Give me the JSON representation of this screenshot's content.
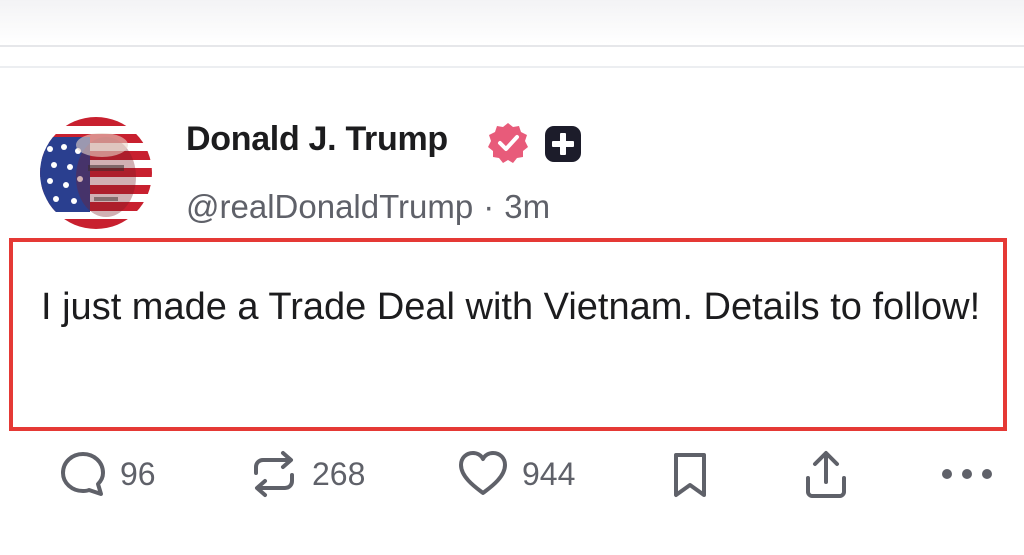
{
  "post": {
    "author": {
      "name": "Donald J. Trump",
      "handle": "@realDonaldTrump",
      "separator": "·",
      "time": "3m"
    },
    "text": "I just made a Trade Deal with Vietnam. Details to follow!",
    "badges": {
      "verified": "verified-icon",
      "plus": "plus-icon"
    }
  },
  "actions": {
    "replies": {
      "icon": "reply-icon",
      "count": "96"
    },
    "retruths": {
      "icon": "repost-icon",
      "count": "268"
    },
    "likes": {
      "icon": "heart-icon",
      "count": "944"
    },
    "bookmark": {
      "icon": "bookmark-icon"
    },
    "share": {
      "icon": "share-icon"
    },
    "more": {
      "icon": "more-icon"
    }
  },
  "colors": {
    "verified_badge": "#e85b7a",
    "highlight_border": "#e53935",
    "icon_gray": "#5f6169",
    "text_dark": "#1c1c1e"
  }
}
